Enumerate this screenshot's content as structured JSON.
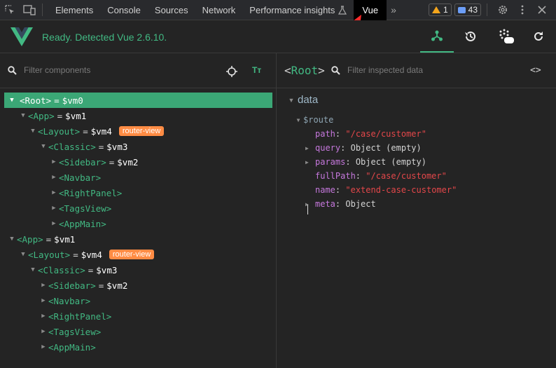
{
  "tabbar": {
    "tabs": [
      "Elements",
      "Console",
      "Sources",
      "Network",
      "Performance insights",
      "Vue"
    ],
    "active": "Vue",
    "warnings": "1",
    "messages": "43"
  },
  "header": {
    "status": "Ready. Detected Vue 2.6.10."
  },
  "components": {
    "filter_placeholder": "Filter components",
    "tree": [
      {
        "tag": "<Root>",
        "vm": "$vm0"
      },
      {
        "tag": "<App>",
        "vm": "$vm1"
      },
      {
        "tag": "<Layout>",
        "vm": "$vm4",
        "badge": "router-view"
      },
      {
        "tag": "<Classic>",
        "vm": "$vm3"
      },
      {
        "tag": "<Sidebar>",
        "vm": "$vm2"
      },
      {
        "tag": "<Navbar>"
      },
      {
        "tag": "<RightPanel>"
      },
      {
        "tag": "<TagsView>"
      },
      {
        "tag": "<AppMain>"
      },
      {
        "tag": "<App>",
        "vm": "$vm1"
      },
      {
        "tag": "<Layout>",
        "vm": "$vm4",
        "badge": "router-view"
      },
      {
        "tag": "<Classic>",
        "vm": "$vm3"
      },
      {
        "tag": "<Sidebar>",
        "vm": "$vm2"
      },
      {
        "tag": "<Navbar>"
      },
      {
        "tag": "<RightPanel>"
      },
      {
        "tag": "<TagsView>"
      },
      {
        "tag": "<AppMain>"
      }
    ]
  },
  "inspector": {
    "selected": "<Root>",
    "filter_placeholder": "Filter inspected data",
    "section": "data",
    "route_key": "$route",
    "props": [
      {
        "key": "path",
        "value": "\"/case/customer\"",
        "kind": "string"
      },
      {
        "key": "query",
        "value": "Object (empty)",
        "kind": "object"
      },
      {
        "key": "params",
        "value": "Object (empty)",
        "kind": "object"
      },
      {
        "key": "fullPath",
        "value": "\"/case/customer\"",
        "kind": "string"
      },
      {
        "key": "name",
        "value": "\"extend-case-customer\"",
        "kind": "string"
      },
      {
        "key": "meta",
        "value": "Object",
        "kind": "object"
      }
    ],
    "eq": "=",
    "colon": ":"
  },
  "colors": {
    "accent": "#42b983",
    "selected_row": "#3ba776",
    "badge": "#ff8c44",
    "annotation_arrow": "#ff2a2a"
  }
}
